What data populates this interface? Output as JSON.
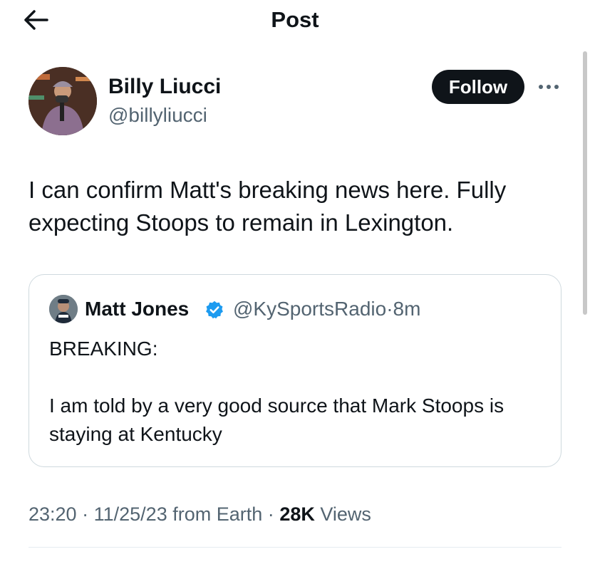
{
  "header": {
    "title": "Post"
  },
  "author": {
    "name": "Billy Liucci",
    "handle": "@billyliucci",
    "follow_label": "Follow"
  },
  "post": {
    "text": "I can confirm Matt's breaking news here. Fully expecting Stoops to remain in Lexington."
  },
  "quote": {
    "name": "Matt Jones",
    "handle": "@KySportsRadio",
    "separator": "·",
    "time": "8m",
    "line1": "BREAKING:",
    "line2": "I am told by a very good source that Mark Stoops is staying at Kentucky",
    "verified_color": "#1d9bf0"
  },
  "meta": {
    "time": "23:20",
    "date": "11/25/23",
    "source": "from Earth",
    "views_count": "28K",
    "views_label": "Views"
  },
  "icons": {
    "back": "arrow-left-icon",
    "more": "more-horizontal-icon",
    "verified": "verified-badge-icon"
  }
}
